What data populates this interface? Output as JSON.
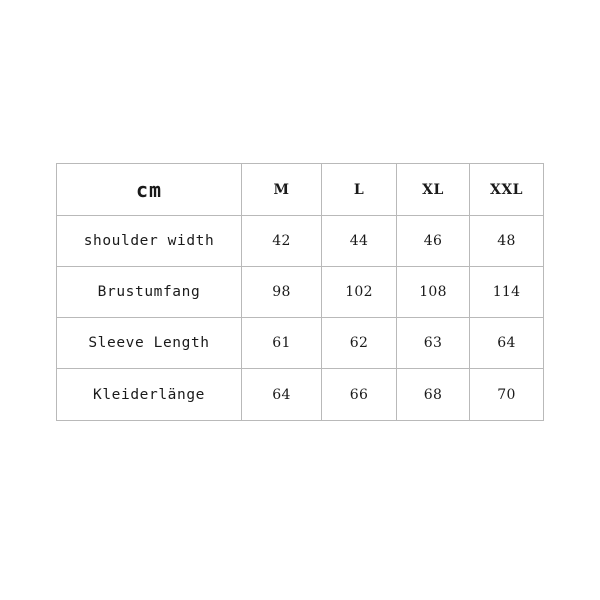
{
  "document": {
    "type": "size-chart-table",
    "background_color": "#ffffff",
    "border_color": "#b9b9b9",
    "text_color": "#1a1a1a"
  },
  "table": {
    "unit_label": "cm",
    "size_columns": [
      "M",
      "L",
      "XL",
      "XXL"
    ],
    "rows": [
      {
        "label": "shoulder width",
        "values": [
          "42",
          "44",
          "46",
          "48"
        ]
      },
      {
        "label": "Brustumfang",
        "values": [
          "98",
          "102",
          "108",
          "114"
        ]
      },
      {
        "label": "Sleeve Length",
        "values": [
          "61",
          "62",
          "63",
          "64"
        ]
      },
      {
        "label": "Kleiderlänge",
        "values": [
          "64",
          "66",
          "68",
          "70"
        ]
      }
    ]
  }
}
